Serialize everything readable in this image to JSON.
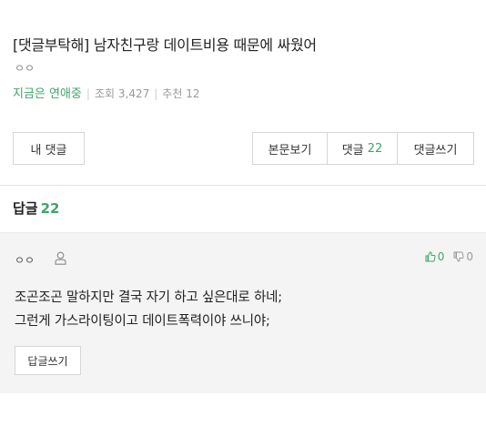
{
  "post": {
    "title": "[댓글부탁해] 남자친구랑 데이트비용 때문에 싸웠어",
    "author": "ㅇㅇ",
    "board": "지금은 연애중",
    "views_label": "조회",
    "views": "3,427",
    "recommend_label": "추천",
    "recommend": "12"
  },
  "toolbar": {
    "my_comments": "내 댓글",
    "view_body": "본문보기",
    "comments_label": "댓글",
    "comments_count": "22",
    "write_comment": "댓글쓰기"
  },
  "replies": {
    "header": "답글",
    "count": "22"
  },
  "comment": {
    "author": "ㅇㅇ",
    "likes": "0",
    "dislikes": "0",
    "lines": [
      "조곤조곤 말하지만 결국 자기 하고 싶은대로 하네;",
      "그런게 가스라이팅이고 데이트폭력이야 쓰니야;"
    ],
    "reply_button": "답글쓰기"
  },
  "colors": {
    "accent": "#3fa56a",
    "comment_bg": "#f4f4f4",
    "border": "#d6d6d6"
  }
}
